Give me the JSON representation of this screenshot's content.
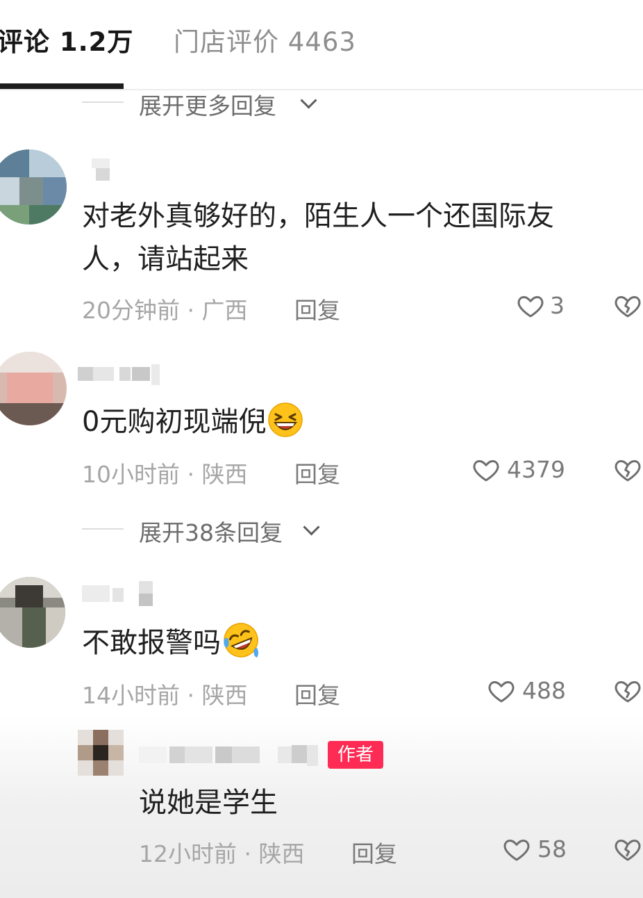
{
  "tabs": {
    "comments_label": "评论 1.2万",
    "store_reviews_label": "门店评价 4463"
  },
  "expand_more_label": "展开更多回复",
  "comments": [
    {
      "text_line1": "对老外真够好的，陌生人一个还国际友",
      "text_line2": "人，请站起来",
      "meta": "20分钟前 · 广西",
      "reply_label": "回复",
      "likes": "3"
    },
    {
      "text": "0元购初现端倪",
      "emoji": "grinning-squint-emoji",
      "meta": "10小时前 · 陕西",
      "reply_label": "回复",
      "likes": "4379",
      "expand_label": "展开38条回复"
    },
    {
      "text": "不敢报警吗",
      "emoji": "rolling-laughing-emoji",
      "meta": "14小时前 · 陕西",
      "reply_label": "回复",
      "likes": "488"
    }
  ],
  "reply": {
    "badge": "作者",
    "text": "说她是学生",
    "meta": "12小时前 · 陕西",
    "reply_label": "回复",
    "likes": "58"
  },
  "colors": {
    "author_badge": "#fe2c55",
    "meta_text": "#a6a6a6",
    "emoji_yellow": "#ffc21a"
  },
  "icons": [
    "heart-icon",
    "broken-heart-icon",
    "chevron-down-icon"
  ]
}
